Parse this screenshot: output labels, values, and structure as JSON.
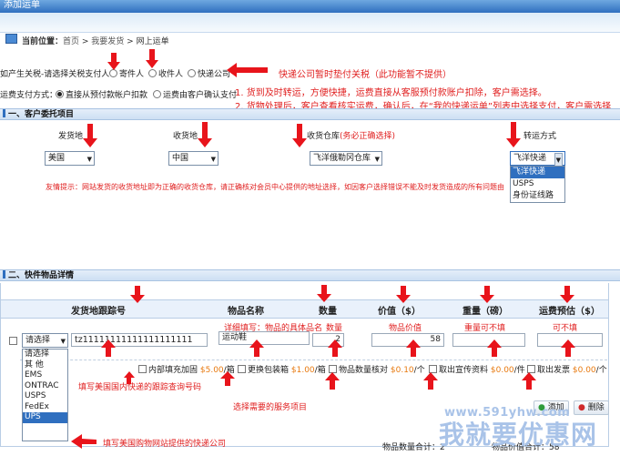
{
  "window": {
    "title": "添加运单"
  },
  "breadcrumb": {
    "label": "当前位置：",
    "home": "首页",
    "sep1": " > ",
    "mine": "我要发货",
    "sep2": " > ",
    "current": "网上运单"
  },
  "tax": {
    "label": "如产生关税-请选择关税支付人：",
    "opt1": "寄件人",
    "opt2": "收件人",
    "opt3": "快递公司",
    "note": "快递公司暂时垫付关税（此功能暂不提供）"
  },
  "freight": {
    "label": "运费支付方式：",
    "opt1": "直接从预付款帐户扣款",
    "opt2": "运费由客户确认支付",
    "note1": "1. 货到及时转运，方便快捷，运费直接从客服预付款账户扣除，客户需选择。",
    "note2": "2. 货物处理后，客户查看核实运费，确认后，在“我的快递运单”列表中选择支付，客户需选择"
  },
  "section1": {
    "title": "一、客户委托项目"
  },
  "entrust": {
    "from_label": "发货地",
    "to_label": "收货地",
    "wh_label": "收货仓库",
    "wh_hint": "(务必正确选择)",
    "ship_label": "转运方式",
    "from_value": "美国",
    "to_value": "中国",
    "wh_value": "飞洋俄勒冈仓库",
    "ship_value": "飞洋快递",
    "ship_options": [
      "飞洋快递",
      "USPS",
      "身份证线路"
    ],
    "tip": "友情提示：网站发货的收货地址即为正确的收货仓库，请正确核对会员中心提供的地址选择，如因客户选择错误不能及时发货造成的所有问题由"
  },
  "section2": {
    "title": "二、快件物品详情"
  },
  "table": {
    "headers": [
      "发货地跟踪号",
      "物品名称",
      "数量",
      "价值（$）",
      "重量（磅）",
      "运费预估（$）"
    ],
    "annotations": {
      "name": "详细填写：物品的具体品名",
      "qty": "数量",
      "value": "物品价值",
      "weight": "重量可不填",
      "fee": "可不填"
    },
    "row": {
      "carrier": "请选择",
      "tracking": "tz11111111111111111111",
      "name": "运动鞋",
      "qty": "2",
      "value": "58",
      "weight": "",
      "fee": ""
    },
    "carrier_options": [
      "请选择",
      "其 他",
      "EMS",
      "ONTRAC",
      "USPS",
      "FedEx",
      "UPS"
    ],
    "services": [
      {
        "label": "内部填充加固",
        "price": "$5.00",
        "unit": "/箱"
      },
      {
        "label": "更换包装箱",
        "price": "$1.00",
        "unit": "/箱"
      },
      {
        "label": "物品数量核对",
        "price": "$0.10",
        "unit": "/个"
      },
      {
        "label": "取出宣传资料",
        "price": "$0.00",
        "unit": "/件"
      },
      {
        "label": "取出发票",
        "price": "$0.00",
        "unit": "/个"
      }
    ]
  },
  "hints": {
    "tracking": "填写美国国内快递的跟踪查询号码",
    "service": "选择需要的服务项目",
    "carrier": "填写美国购物网站提供的快递公司"
  },
  "actions": {
    "add": "添加",
    "delete": "删除"
  },
  "totals": {
    "qty_label": "物品数量合计：",
    "qty": "2",
    "value_label": "物品价值合计：",
    "value": "58"
  },
  "watermark": {
    "url": "www.591yhw.com",
    "text": "我就要优惠网"
  },
  "colors": {
    "accent": "#2f6fbf",
    "annotation": "#e02020",
    "price": "#e87a10",
    "arrow": "#e8141b"
  }
}
